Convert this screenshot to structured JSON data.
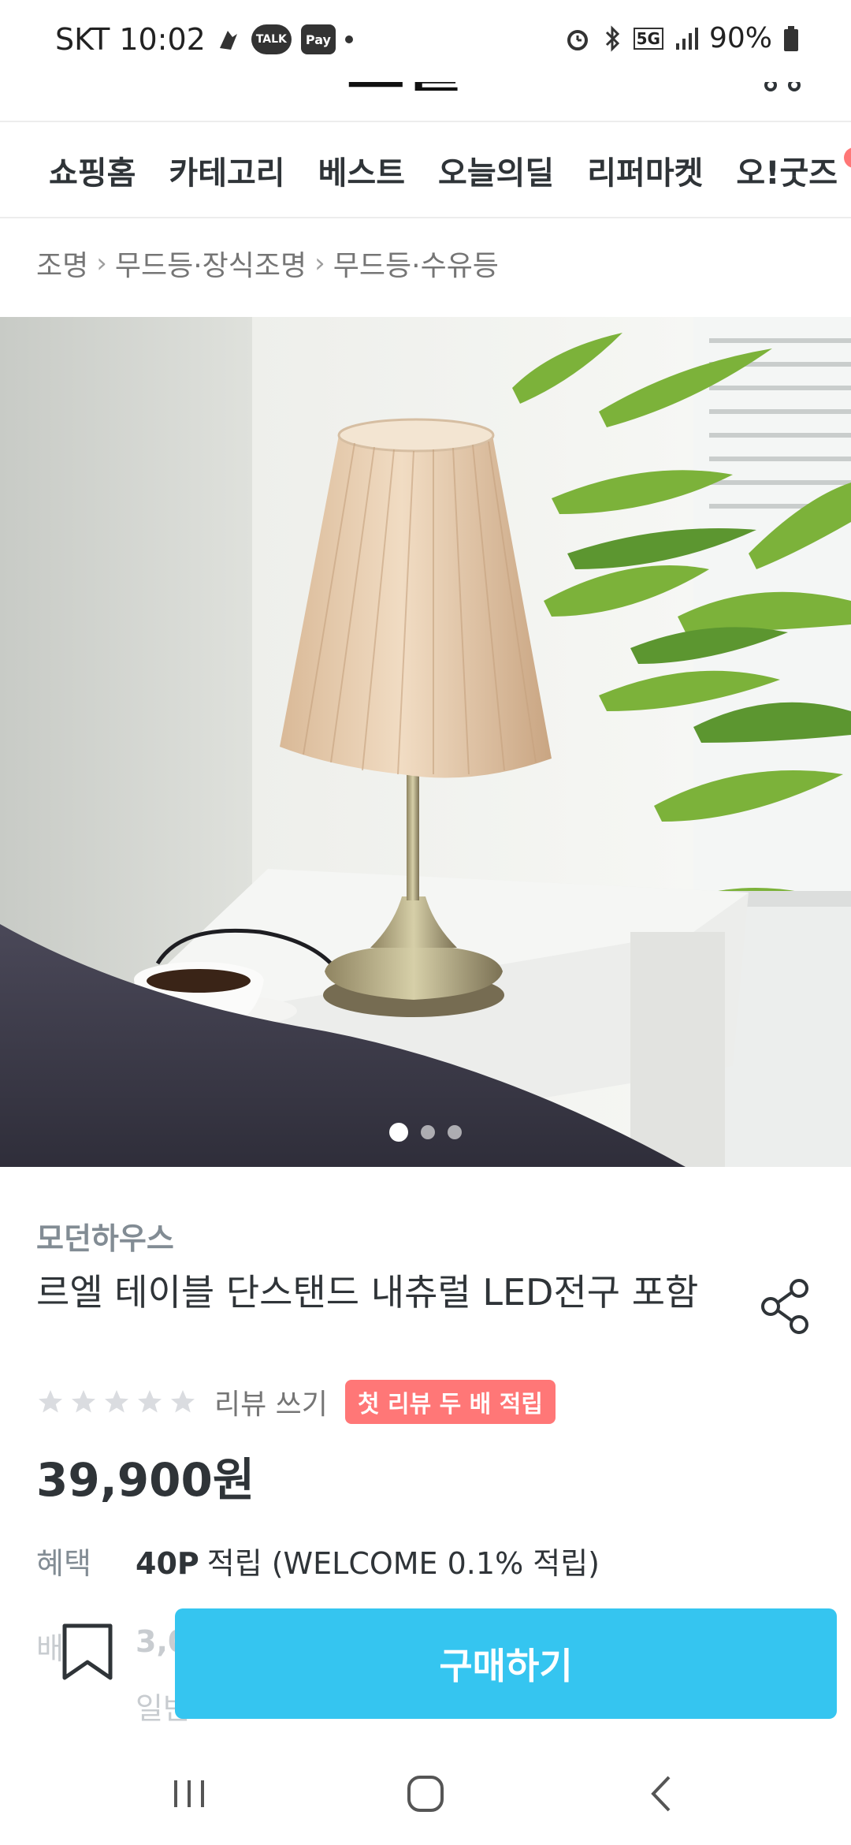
{
  "status_bar": {
    "carrier": "SKT",
    "time": "10:02",
    "talk_label": "TALK",
    "pay_label": "Pay",
    "network": "5G",
    "battery": "90%"
  },
  "header": {
    "logo_text": "오늘의집"
  },
  "nav": {
    "items": [
      {
        "label": "쇼핑홈"
      },
      {
        "label": "카테고리"
      },
      {
        "label": "베스트"
      },
      {
        "label": "오늘의딜"
      },
      {
        "label": "리퍼마켓"
      },
      {
        "label": "오!굿즈"
      }
    ]
  },
  "breadcrumb": {
    "items": [
      "조명",
      "무드등·장식조명",
      "무드등·수유등"
    ]
  },
  "gallery": {
    "total_pages": 3,
    "current_page": 1
  },
  "product": {
    "brand": "모던하우스",
    "title": "르엘 테이블 단스탠드 내츄럴 LED전구 포함",
    "rating_stars": 0,
    "review_link": "리뷰 쓰기",
    "promo_badge": "첫 리뷰 두 배 적립",
    "price": "39,900원"
  },
  "benefit": {
    "label": "혜택",
    "points": "40P",
    "text": "적립 (WELCOME 0.1% 적립)"
  },
  "shipping": {
    "label": "배송",
    "value": "3,0",
    "sub": "일반"
  },
  "actions": {
    "buy_label": "구매하기"
  },
  "colors": {
    "accent": "#35c5f0",
    "badge": "#ff7777",
    "text": "#2f3438",
    "muted": "#828c94"
  }
}
